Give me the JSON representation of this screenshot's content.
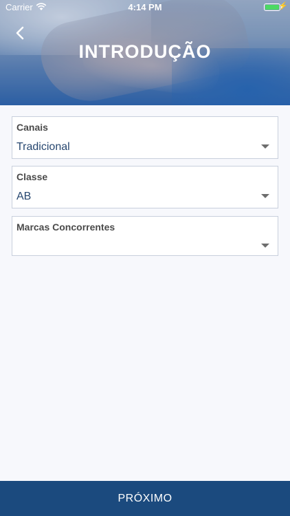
{
  "status_bar": {
    "carrier": "Carrier",
    "time": "4:14 PM",
    "battery_color": "#4cd964"
  },
  "header": {
    "title": "INTRODUÇÃO",
    "back_icon": "chevron-left-icon"
  },
  "form": {
    "fields": [
      {
        "label": "Canais",
        "value": "Tradicional"
      },
      {
        "label": "Classe",
        "value": "AB"
      },
      {
        "label": "Marcas Concorrentes",
        "value": ""
      }
    ]
  },
  "footer": {
    "next_label": "PRÓXIMO",
    "bg_color": "#1b4a7e"
  }
}
